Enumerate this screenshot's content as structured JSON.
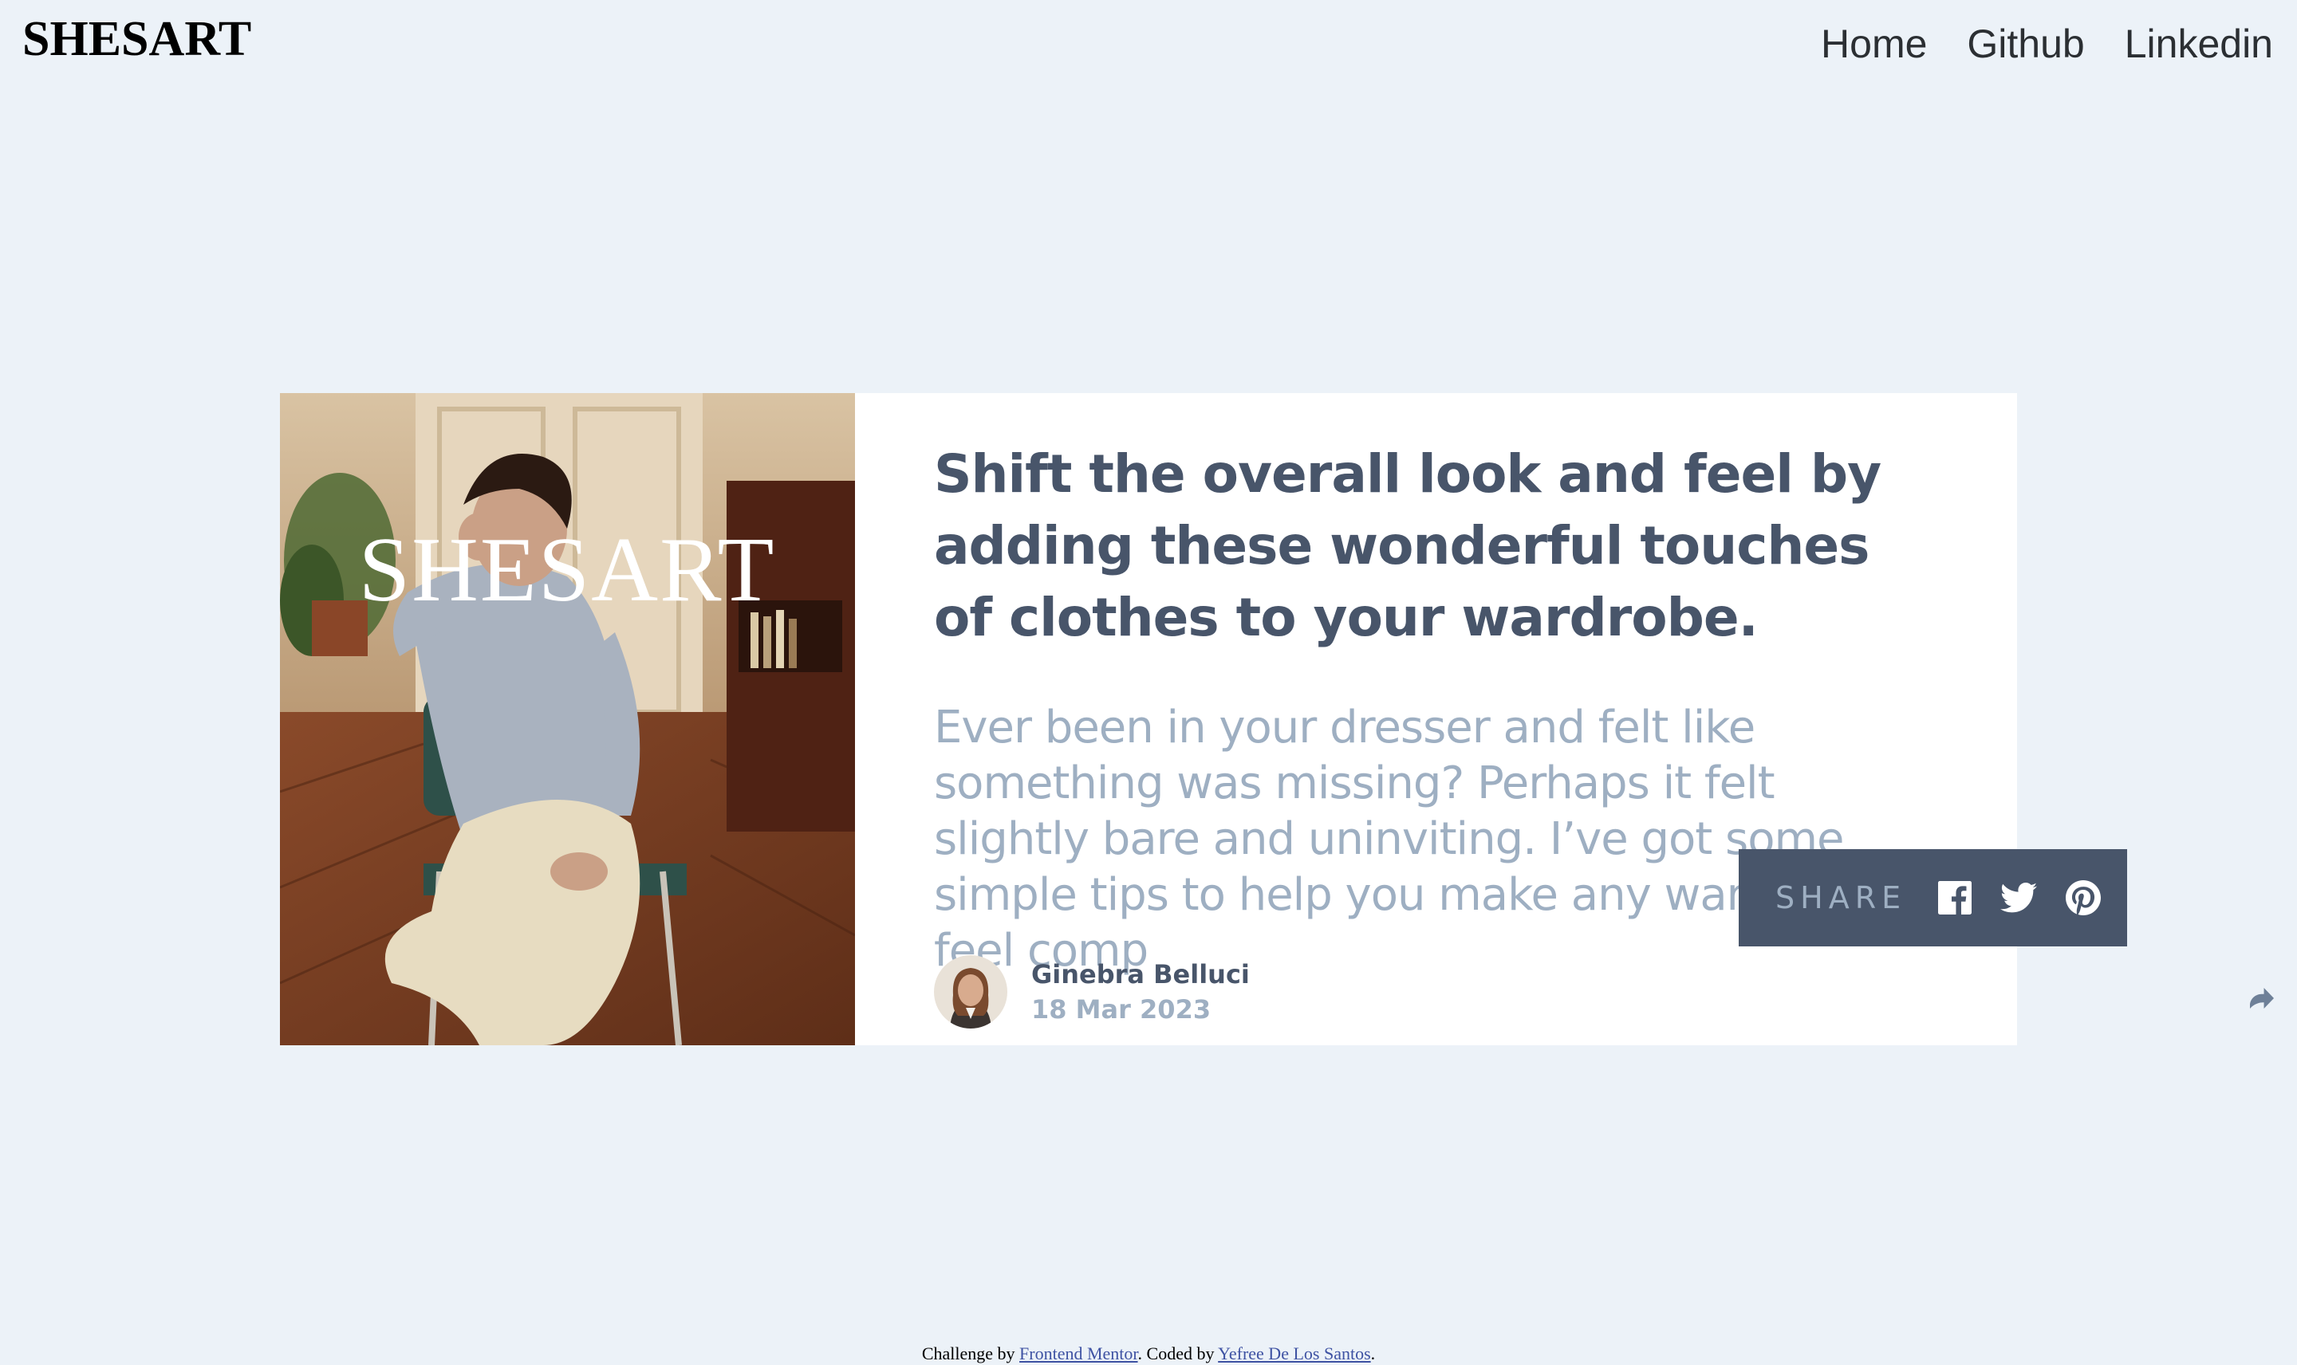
{
  "header": {
    "brand": "SHESART",
    "nav": [
      {
        "label": "Home"
      },
      {
        "label": "Github"
      },
      {
        "label": "Linkedin"
      }
    ]
  },
  "card": {
    "image_overlay_text": "SHESART",
    "headline": "Shift the overall look and feel by adding these wonderful touches of clothes to your wardrobe.",
    "excerpt": "Ever been in your dresser and felt like something was missing? Perhaps it felt slightly bare and uninviting. I’ve got some simple tips to help you make any wardrobe feel comp",
    "author": {
      "name": "Ginebra Belluci",
      "date": "18 Mar 2023"
    },
    "share": {
      "label": "SHARE",
      "icons": [
        "facebook-icon",
        "twitter-icon",
        "pinterest-icon"
      ]
    }
  },
  "footer": {
    "prefix": "Challenge by ",
    "link1": "Frontend Mentor",
    "middle": ". Coded by ",
    "link2": "Yefree De Los Santos",
    "suffix": "."
  },
  "colors": {
    "background": "#ecf2f8",
    "card": "#ffffff",
    "dark": "#48556a",
    "muted": "#9eafc2"
  }
}
